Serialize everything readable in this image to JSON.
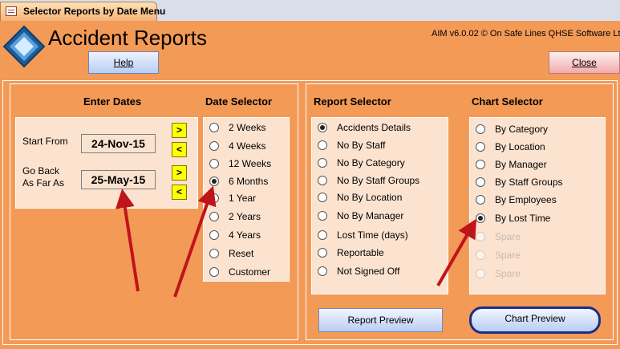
{
  "window": {
    "tab_title": "Selector Reports by Date Menu"
  },
  "header": {
    "title": "Accident Reports",
    "version": "AIM v6.0.02 © On Safe Lines QHSE Software Ltd",
    "help_label": "Help",
    "close_label": "Close"
  },
  "dates": {
    "heading": "Enter Dates",
    "start_label": "Start From",
    "start_value": "24-Nov-15",
    "back_label_1": "Go Back",
    "back_label_2": "As Far As",
    "back_value": "25-May-15",
    "next_glyph": ">",
    "prev_glyph": "<"
  },
  "date_selector": {
    "heading": "Date Selector",
    "selected": "6 Months",
    "options": [
      "2  Weeks",
      "4  Weeks",
      "12 Weeks",
      "6 Months",
      "1 Year",
      "2 Years",
      "4 Years",
      "Reset",
      "Customer"
    ]
  },
  "report_selector": {
    "heading": "Report Selector",
    "selected": "Accidents Details",
    "options": [
      "Accidents Details",
      "No By Staff",
      "No By Category",
      "No By Staff Groups",
      "No By Location",
      "No By Manager",
      "Lost Time (days)",
      "Reportable",
      "Not Signed Off"
    ],
    "preview_label": "Report Preview"
  },
  "chart_selector": {
    "heading": "Chart Selector",
    "selected": "By Lost Time",
    "options": [
      "By Category",
      "By Location",
      "By Manager",
      "By Staff Groups",
      "By Employees",
      "By Lost Time",
      "Spare",
      "Spare",
      "Spare"
    ],
    "preview_label": "Chart Preview"
  },
  "colors": {
    "background": "#f39a57",
    "panel": "#fce3d0",
    "arrow": "#c0141b",
    "focus_ring": "#1b2d87",
    "date_button": "#ffff00"
  }
}
